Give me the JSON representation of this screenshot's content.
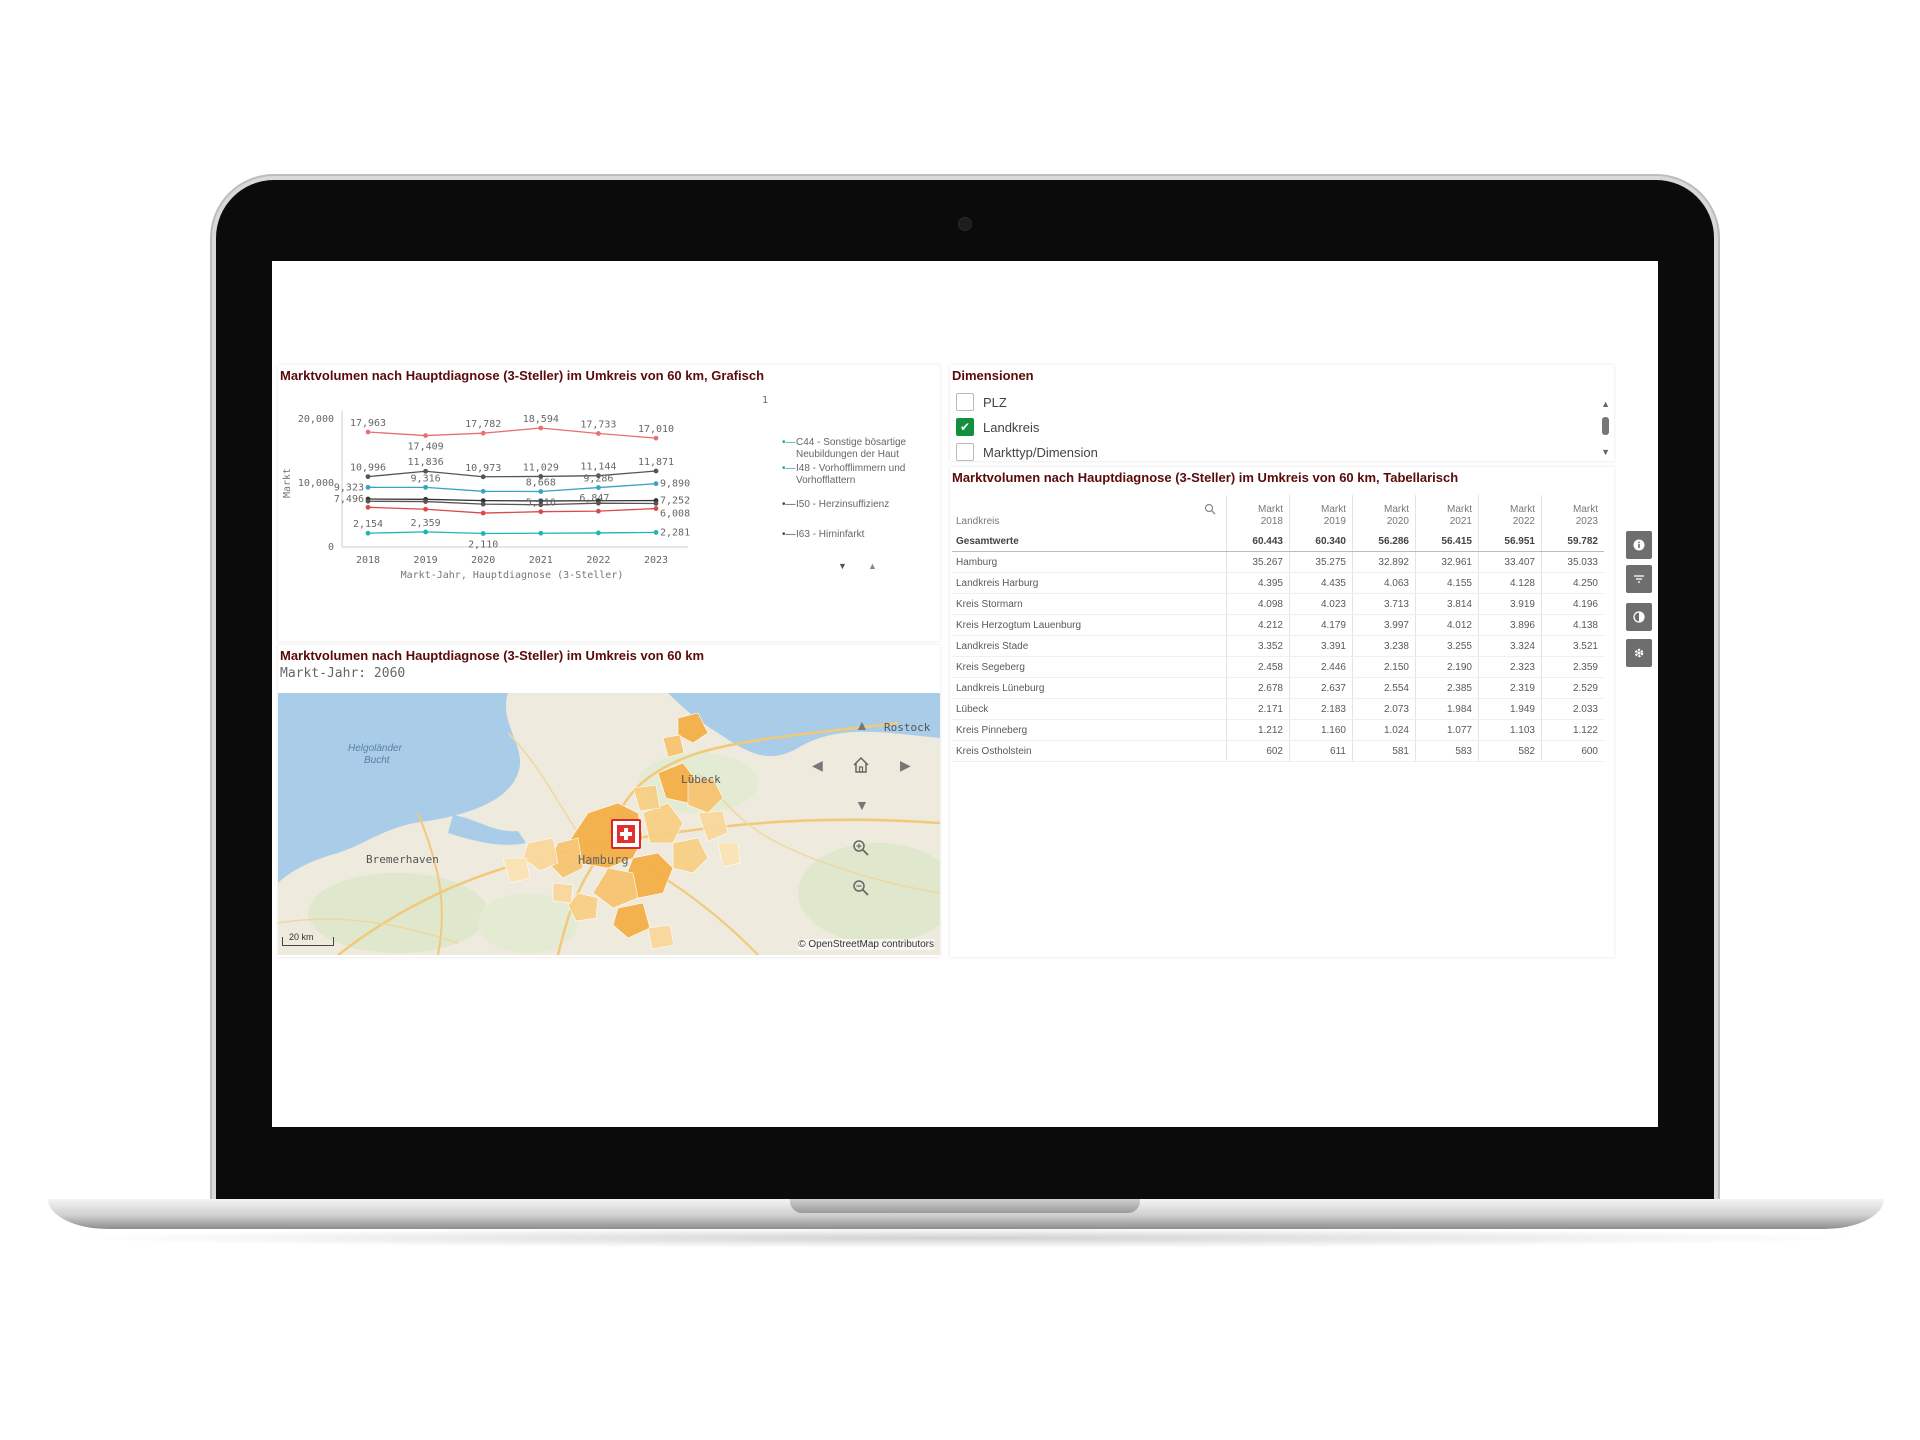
{
  "chart_panel": {
    "title": "Marktvolumen nach Hauptdiagnose (3-Steller) im Umkreis von 60 km, Grafisch",
    "page_indicator": "1",
    "legend": [
      {
        "label": "C44 - Sonstige bösartige Neubildungen der Haut",
        "color": "#1aa79a"
      },
      {
        "label": "I48 - Vorhofflimmern und Vorhofflattern",
        "color": "#2b97b8"
      },
      {
        "label": "I50 - Herzinsuffizienz",
        "color": "#444444"
      },
      {
        "label": "I63 - Hirninfarkt",
        "color": "#444444"
      }
    ]
  },
  "chart_data": {
    "type": "line",
    "x": [
      "2018",
      "2019",
      "2020",
      "2021",
      "2022",
      "2023"
    ],
    "xlabel": "Markt-Jahr, Hauptdiagnose (3-Steller)",
    "ylabel": "Markt",
    "yticks": [
      "0",
      "10,000",
      "20,000"
    ],
    "ylim": [
      0,
      20000
    ],
    "grid": false,
    "series": [
      {
        "color": "#e8706f",
        "values": [
          17963,
          17409,
          17782,
          18594,
          17733,
          17010
        ],
        "labels": [
          "17,963",
          "17,409",
          "17,782",
          "18,594",
          "17,733",
          "17,010"
        ]
      },
      {
        "color": "#555555",
        "values": [
          10996,
          11836,
          10973,
          11029,
          11144,
          11871
        ],
        "labels": [
          "10,996",
          "11,836",
          "10,973",
          "11,029",
          "11,144",
          "11,871"
        ]
      },
      {
        "color": "#3aa3c1",
        "values": [
          9323,
          9316,
          8700,
          8668,
          9286,
          9890
        ],
        "labels": [
          "9,323",
          "9,316",
          "",
          "8,668",
          "9,286",
          "9,890"
        ]
      },
      {
        "color": "#333333",
        "values": [
          7496,
          7450,
          7250,
          7200,
          7230,
          7252
        ],
        "labels": [
          "7,496",
          "",
          "",
          "",
          "",
          "7,252"
        ]
      },
      {
        "color": "#555555",
        "values": [
          7150,
          7100,
          6700,
          6600,
          6847,
          6800
        ],
        "labels": [
          "",
          "",
          "",
          "",
          "6,847",
          ""
        ]
      },
      {
        "color": "#d94b4b",
        "values": [
          6200,
          5900,
          5300,
          5516,
          5600,
          6008
        ],
        "labels": [
          "",
          "",
          "",
          "5,516",
          "",
          "6,008"
        ]
      },
      {
        "color": "#1fb5b0",
        "values": [
          2154,
          2359,
          2110,
          2150,
          2200,
          2281
        ],
        "labels": [
          "2,154",
          "2,359",
          "2,110",
          "",
          "",
          "2,281"
        ]
      }
    ]
  },
  "map_panel": {
    "title": "Marktvolumen nach Hauptdiagnose (3-Steller) im Umkreis von 60 km",
    "subtitle": "Markt-Jahr: 2060",
    "places": {
      "helgolaender": "Helgoländer",
      "bucht": "Bucht",
      "bremerhaven": "Bremerhaven",
      "luebeck": "Lübeck",
      "rostock": "Rostock",
      "hamburg": "Hamburg"
    },
    "scale": "20 km",
    "attribution": "© OpenStreetMap contributors"
  },
  "dimensions": {
    "title": "Dimensionen",
    "items": [
      {
        "label": "PLZ",
        "checked": false
      },
      {
        "label": "Landkreis",
        "checked": true
      },
      {
        "label": "Markttyp/Dimension",
        "checked": false
      }
    ]
  },
  "table_panel": {
    "title": "Marktvolumen nach Hauptdiagnose (3-Steller) im Umkreis von 60 km, Tabellarisch",
    "columns": [
      "Landkreis",
      "Markt 2018",
      "Markt 2019",
      "Markt 2020",
      "Markt 2021",
      "Markt 2022",
      "Markt 2023"
    ],
    "total": [
      "Gesamtwerte",
      "60.443",
      "60.340",
      "56.286",
      "56.415",
      "56.951",
      "59.782"
    ],
    "rows": [
      [
        "Hamburg",
        "35.267",
        "35.275",
        "32.892",
        "32.961",
        "33.407",
        "35.033"
      ],
      [
        "Landkreis Harburg",
        "4.395",
        "4.435",
        "4.063",
        "4.155",
        "4.128",
        "4.250"
      ],
      [
        "Kreis Stormarn",
        "4.098",
        "4.023",
        "3.713",
        "3.814",
        "3.919",
        "4.196"
      ],
      [
        "Kreis Herzogtum Lauenburg",
        "4.212",
        "4.179",
        "3.997",
        "4.012",
        "3.896",
        "4.138"
      ],
      [
        "Landkreis Stade",
        "3.352",
        "3.391",
        "3.238",
        "3.255",
        "3.324",
        "3.521"
      ],
      [
        "Kreis Segeberg",
        "2.458",
        "2.446",
        "2.150",
        "2.190",
        "2.323",
        "2.359"
      ],
      [
        "Landkreis Lüneburg",
        "2.678",
        "2.637",
        "2.554",
        "2.385",
        "2.319",
        "2.529"
      ],
      [
        "Lübeck",
        "2.171",
        "2.183",
        "2.073",
        "1.984",
        "1.949",
        "2.033"
      ],
      [
        "Kreis Pinneberg",
        "1.212",
        "1.160",
        "1.024",
        "1.077",
        "1.103",
        "1.122"
      ],
      [
        "Kreis Ostholstein",
        "602",
        "611",
        "581",
        "583",
        "582",
        "600"
      ]
    ]
  },
  "toolbar": {
    "icons": [
      "info-icon",
      "filter-icon",
      "theme-icon",
      "settings-icon"
    ]
  }
}
